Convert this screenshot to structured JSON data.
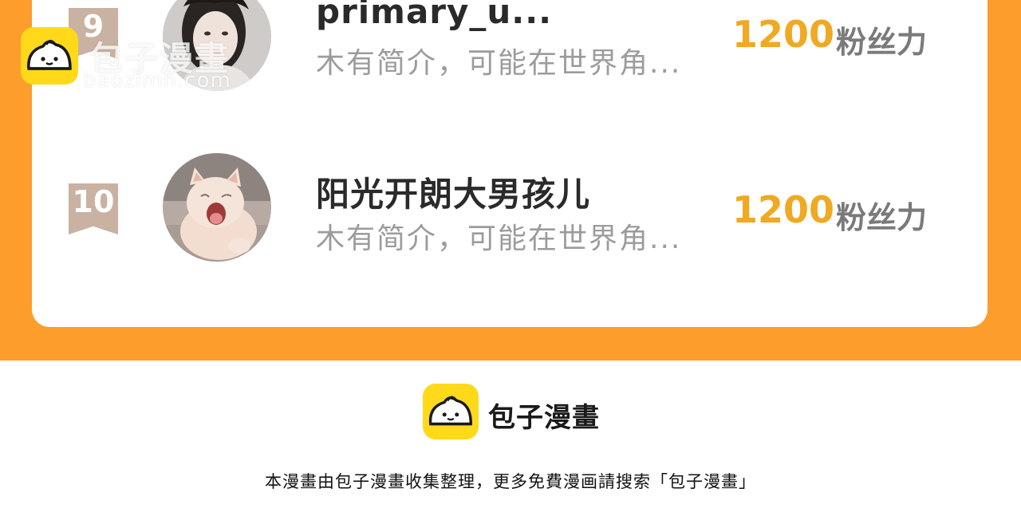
{
  "colors": {
    "background_orange": "#fd9d2b",
    "card": "#ffffff",
    "fans_value": "#f0a922",
    "rank_9_badge": "#c9b2a2",
    "rank_10_badge": "#c9b2a2",
    "logo_yellow": "#ffd91a"
  },
  "ranking": [
    {
      "rank": "9",
      "avatar_icon": "girl-portrait-avatar",
      "name": "primary_u...",
      "intro": "木有简介，可能在世界角...",
      "fans_value": "1200",
      "fans_unit": "粉丝力"
    },
    {
      "rank": "10",
      "avatar_icon": "yawning-cat-avatar",
      "name": "阳光开朗大男孩儿",
      "intro": "木有简介，可能在世界角...",
      "fans_value": "1200",
      "fans_unit": "粉丝力"
    }
  ],
  "watermark": {
    "brand": "包子漫畫",
    "url": "baozimh.com",
    "icon": "bun-logo-icon"
  },
  "footer": {
    "brand": "包子漫畫",
    "note": "本漫畫由包子漫畫收集整理，更多免費漫画請搜索「包子漫畫」",
    "icon": "bun-logo-icon"
  }
}
